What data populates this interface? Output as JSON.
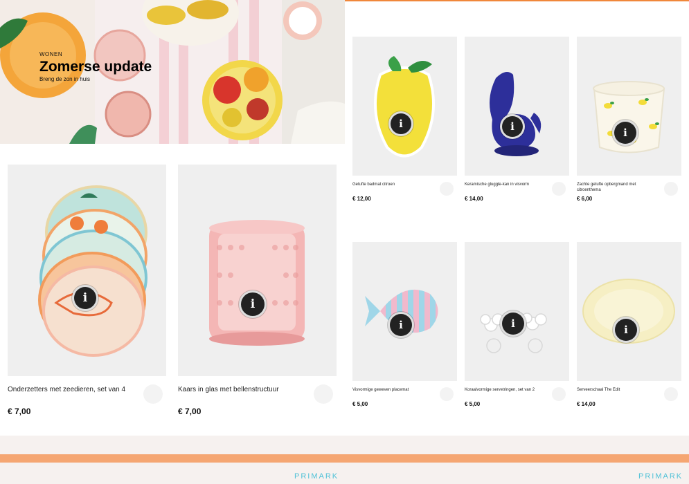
{
  "hero": {
    "eyebrow": "WONEN",
    "title": "Zomerse update",
    "subtitle": "Breng de zon in huis"
  },
  "products_large": [
    {
      "name": "Onderzetters met zeedieren, set van 4",
      "price": "€ 7,00",
      "image": "coasters-image"
    },
    {
      "name": "Kaars in glas met bellenstructuur",
      "price": "€ 7,00",
      "image": "candle-image"
    }
  ],
  "products_small": [
    {
      "name": "Getufte badmat citroen",
      "price": "€ 12,00",
      "image": "lemon-bathmat-image"
    },
    {
      "name": "Keramische gluggle-kan in visvorm",
      "price": "€ 14,00",
      "image": "fish-jug-image"
    },
    {
      "name": "Zachte getufte opbergmand met citroenthema",
      "price": "€ 6,00",
      "image": "lemon-basket-image"
    },
    {
      "name": "Visvormige geweven placemat",
      "price": "€ 5,00",
      "image": "fish-placemat-image"
    },
    {
      "name": "Koraalvormige servetringen, set van 2",
      "price": "€ 5,00",
      "image": "napkin-rings-image"
    },
    {
      "name": "Serveerschaal The Edit",
      "price": "€ 14,00",
      "image": "serving-dish-image"
    }
  ],
  "info_icon_glyph": "i",
  "footer": {
    "brand_left": "PRIMARK",
    "brand_right": "PRIMARK"
  },
  "colors": {
    "accent_orange": "#f5a672",
    "brand_blue": "#4fc1d7",
    "topline": "#f0873a"
  }
}
